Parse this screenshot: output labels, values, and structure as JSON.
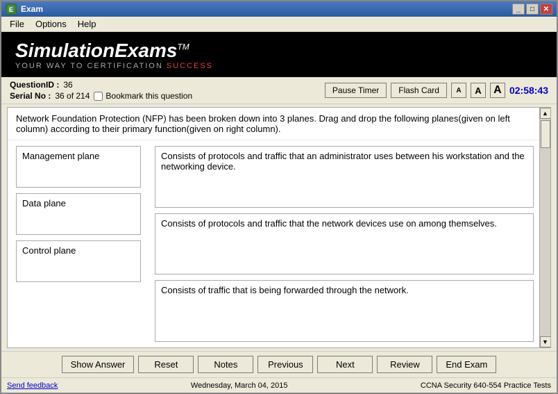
{
  "window": {
    "title": "Exam",
    "icon": "E"
  },
  "menu": {
    "items": [
      "File",
      "Options",
      "Help"
    ]
  },
  "logo": {
    "brand": "SimulationExams",
    "tm": "TM",
    "tagline_plain": "YOUR WAY TO CERTIFICATION ",
    "tagline_accent": "SUCCESS"
  },
  "info_bar": {
    "question_id_label": "QuestionID :",
    "question_id_value": "36",
    "serial_label": "Serial No :",
    "serial_value": "36 of 214",
    "bookmark_label": "Bookmark this question",
    "pause_timer_label": "Pause Timer",
    "flash_card_label": "Flash Card",
    "font_a_small": "A",
    "font_a_medium": "A",
    "font_a_large": "A",
    "timer": "02:58:43"
  },
  "question": {
    "text": "Network Foundation Protection (NFP) has been broken down into 3 planes. Drag and drop  the following planes(given on left column) according to their primary function(given on right column)."
  },
  "planes": [
    {
      "name": "Management plane",
      "description": "Consists of protocols and traffic that an administrator uses between his workstation and the networking device."
    },
    {
      "name": "Data plane",
      "description": "Consists of protocols and traffic that the network devices use on among themselves."
    },
    {
      "name": "Control plane",
      "description": "Consists of traffic that is being forwarded through the network."
    }
  ],
  "buttons": {
    "show_answer": "Show Answer",
    "reset": "Reset",
    "notes": "Notes",
    "previous": "Previous",
    "next": "Next",
    "review": "Review",
    "end_exam": "End Exam"
  },
  "status": {
    "feedback": "Send feedback",
    "date": "Wednesday, March 04, 2015",
    "exam_name": "CCNA Security 640-554 Practice Tests"
  }
}
